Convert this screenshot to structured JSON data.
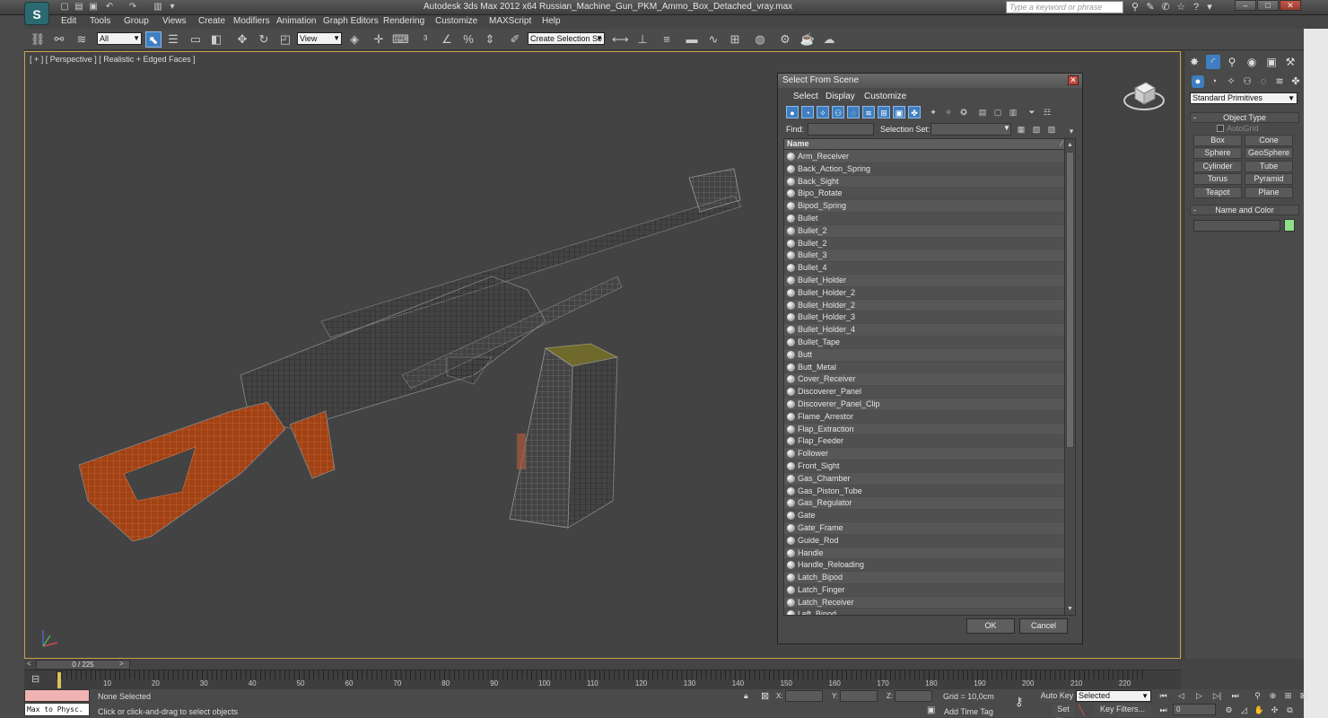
{
  "window": {
    "title": "Autodesk 3ds Max  2012 x64      Russian_Machine_Gun_PKM_Ammo_Box_Detached_vray.max",
    "logo": "S",
    "search_placeholder": "Type a keyword or phrase"
  },
  "menu": [
    "Edit",
    "Tools",
    "Group",
    "Views",
    "Create",
    "Modifiers",
    "Animation",
    "Graph Editors",
    "Rendering",
    "Customize",
    "MAXScript",
    "Help"
  ],
  "toolbar": {
    "selection_filter": "All",
    "ref_coord": "View",
    "named_selection_placeholder": "Create Selection Se"
  },
  "viewport": {
    "label": "[ + ] [ Perspective ] [ Realistic + Edged Faces ]"
  },
  "command_panel": {
    "category": "Standard Primitives",
    "object_type_title": "Object Type",
    "autogrid_label": "AutoGrid",
    "primitives": [
      "Box",
      "Cone",
      "Sphere",
      "GeoSphere",
      "Cylinder",
      "Tube",
      "Torus",
      "Pyramid",
      "Teapot",
      "Plane"
    ],
    "name_color_title": "Name and Color",
    "object_color": "#8fe08a"
  },
  "dialog": {
    "title": "Select From Scene",
    "menu": [
      "Select",
      "Display",
      "Customize"
    ],
    "find_label": "Find:",
    "selection_set_label": "Selection Set:",
    "column_name": "Name",
    "ok": "OK",
    "cancel": "Cancel",
    "items": [
      "Arm_Receiver",
      "Back_Action_Spring",
      "Back_Sight",
      "Bipo_Rotate",
      "Bipod_Spring",
      "Bullet",
      "Bullet_2",
      "Bullet_2",
      "Bullet_3",
      "Bullet_4",
      "Bullet_Holder",
      "Bullet_Holder_2",
      "Bullet_Holder_2",
      "Bullet_Holder_3",
      "Bullet_Holder_4",
      "Bullet_Tape",
      "Butt",
      "Butt_Metal",
      "Cover_Receiver",
      "Discoverer_Panel",
      "Discoverer_Panel_Clip",
      "Flame_Arrestor",
      "Flap_Extraction",
      "Flap_Feeder",
      "Follower",
      "Front_Sight",
      "Gas_Chamber",
      "Gas_Piston_Tube",
      "Gas_Regulator",
      "Gate",
      "Gate_Frame",
      "Guide_Rod",
      "Handle",
      "Handle_Reloading",
      "Latch_Bipod",
      "Latch_Finger",
      "Latch_Receiver",
      "Left_Bipod"
    ]
  },
  "timeline": {
    "frame_display": "0 / 225",
    "ticks": [
      "10",
      "20",
      "30",
      "40",
      "50",
      "60",
      "70",
      "80",
      "90",
      "100",
      "110",
      "120",
      "130",
      "140",
      "150",
      "160",
      "170",
      "180",
      "190",
      "200",
      "210",
      "220"
    ]
  },
  "status": {
    "script_listener": "Max to Physc.",
    "selection_status": "None Selected",
    "prompt": "Click or click-and-drag to select objects",
    "x_label": "X:",
    "y_label": "Y:",
    "z_label": "Z:",
    "grid": "Grid = 10,0cm",
    "auto_key": "Auto Key",
    "set_key": "Set Key",
    "key_mode": "Selected",
    "key_filters": "Key Filters...",
    "add_time_tag": "Add Time Tag",
    "current_frame": "0"
  }
}
